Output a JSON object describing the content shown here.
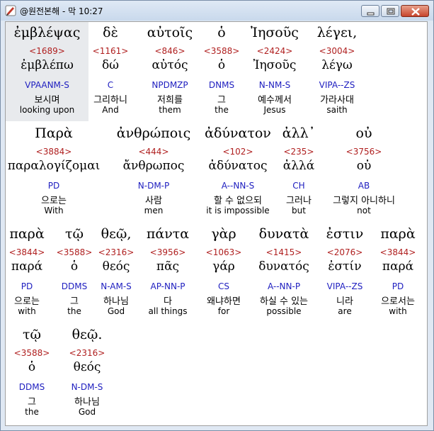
{
  "window": {
    "title": "@원전본해 - 막 10:27"
  },
  "rows": [
    [
      {
        "greek": "ἐμβλέψας",
        "num": "<1689>",
        "lemma": "ἐμβλέπω",
        "parse": "VPAANM-S",
        "kor": "보시며",
        "eng": "looking upon"
      },
      {
        "greek": "δὲ",
        "num": "<1161>",
        "lemma": "δώ",
        "parse": "C",
        "kor": "그리하니",
        "eng": "And"
      },
      {
        "greek": "αὐτοῖς",
        "num": "<846>",
        "lemma": "αὐτός",
        "parse": "NPDMZP",
        "kor": "저희를",
        "eng": "them"
      },
      {
        "greek": "ὁ",
        "num": "<3588>",
        "lemma": "ὁ",
        "parse": "DNMS",
        "kor": "그",
        "eng": "the"
      },
      {
        "greek": "Ἰησοῦς",
        "num": "<2424>",
        "lemma": "Ἰησοῦς",
        "parse": "N-NM-S",
        "kor": "예수께서",
        "eng": "Jesus"
      },
      {
        "greek": "λέγει,",
        "num": "<3004>",
        "lemma": "λέγω",
        "parse": "VIPA--ZS",
        "kor": "가라사대",
        "eng": "saith"
      }
    ],
    [
      {
        "greek": "Παρὰ",
        "num": "<3884>",
        "lemma": "παραλογίζομαι",
        "parse": "PD",
        "kor": "으로는",
        "eng": "With"
      },
      {
        "greek": "ἀνθρώποις",
        "num": "<444>",
        "lemma": "ἄνθρωπος",
        "parse": "N-DM-P",
        "kor": "사람",
        "eng": "men"
      },
      {
        "greek": "ἀδύνατον",
        "num": "<102>",
        "lemma": "ἀδύνατος",
        "parse": "A--NN-S",
        "kor": "할 수 없으되",
        "eng": "it is impossible"
      },
      {
        "greek": "ἀλλ᾽",
        "num": "<235>",
        "lemma": "ἀλλά",
        "parse": "CH",
        "kor": "그러나",
        "eng": "but"
      },
      {
        "greek": "οὐ",
        "num": "<3756>",
        "lemma": "οὐ",
        "parse": "AB",
        "kor": "그렇지 아니하니",
        "eng": "not"
      }
    ],
    [
      {
        "greek": "παρὰ",
        "num": "<3844>",
        "lemma": "παρά",
        "parse": "PD",
        "kor": "으로는",
        "eng": "with"
      },
      {
        "greek": "τῷ",
        "num": "<3588>",
        "lemma": "ὁ",
        "parse": "DDMS",
        "kor": "그",
        "eng": "the"
      },
      {
        "greek": "θεῷ,",
        "num": "<2316>",
        "lemma": "θεός",
        "parse": "N-AM-S",
        "kor": "하나님",
        "eng": "God"
      },
      {
        "greek": "πάντα",
        "num": "<3956>",
        "lemma": "πᾶς",
        "parse": "AP-NN-P",
        "kor": "다",
        "eng": "all things"
      },
      {
        "greek": "γὰρ",
        "num": "<1063>",
        "lemma": "γάρ",
        "parse": "CS",
        "kor": "왜냐하면",
        "eng": "for"
      },
      {
        "greek": "δυνατὰ",
        "num": "<1415>",
        "lemma": "δυνατός",
        "parse": "A--NN-P",
        "kor": "하실 수 있는",
        "eng": "possible"
      },
      {
        "greek": "ἐστιν",
        "num": "<2076>",
        "lemma": "ἐστίν",
        "parse": "VIPA--ZS",
        "kor": "니라",
        "eng": "are"
      },
      {
        "greek": "παρὰ",
        "num": "<3844>",
        "lemma": "παρά",
        "parse": "PD",
        "kor": "으로서는",
        "eng": "with"
      }
    ],
    [
      {
        "greek": "τῷ",
        "num": "<3588>",
        "lemma": "ὁ",
        "parse": "DDMS",
        "kor": "그",
        "eng": "the"
      },
      {
        "greek": "θεῷ.",
        "num": "<2316>",
        "lemma": "θεός",
        "parse": "N-DM-S",
        "kor": "하나님",
        "eng": "God"
      }
    ]
  ]
}
